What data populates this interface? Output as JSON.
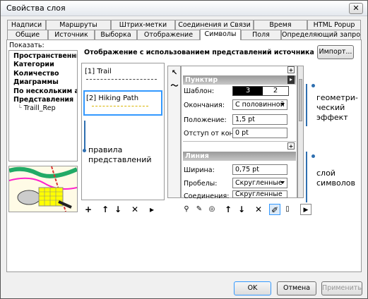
{
  "window": {
    "title": "Свойства слоя",
    "close_glyph": "✕"
  },
  "tabs_back": [
    "Надписи",
    "Маршруты",
    "Штрих-метки",
    "Соединения и Связи",
    "Время",
    "HTML Popup"
  ],
  "tabs_front": [
    "Общие",
    "Источник",
    "Выборка",
    "Отображение",
    "Символы",
    "Поля",
    "Определяющий запрос"
  ],
  "active_tab": "Символы",
  "show_label": "Показать:",
  "categories": [
    "Пространственные объекты",
    "Категории",
    "Количество",
    "Диаграммы",
    "По нескольким атрибутам",
    "Представления"
  ],
  "subcategory": "Traill_Rep",
  "header_text": "Отображение с использованием представлений источника данных объекта",
  "import_button": "Импорт...",
  "rules": [
    "[1] Trail",
    "[2] Hiking Path"
  ],
  "dash_section": {
    "title": "Пунктир",
    "pattern_label": "Шаблон:",
    "pattern_values": [
      "3",
      "2"
    ],
    "ends_label": "Окончания:",
    "ends_value": "С половинной ш",
    "position_label": "Положение:",
    "position_value": "1,5 pt",
    "offset_label": "Отступ от конца:",
    "offset_value": "0 pt"
  },
  "line_section": {
    "title": "Линия",
    "width_label": "Ширина:",
    "width_value": "0,75 pt",
    "caps_label": "Пробелы:",
    "caps_value": "Скругленные",
    "joins_label": "Соединения:",
    "joins_value": "Скругленные"
  },
  "annotations": {
    "rules": "правила представлений",
    "geom": "геометри-ческий эффект",
    "layer": "слой символов"
  },
  "buttons": {
    "ok": "OK",
    "cancel": "Отмена",
    "apply": "Применить"
  },
  "colors": {
    "accent": "#2e6fb0",
    "selected_rule_border": "#3399ff",
    "dash_yellow": "#d9b300"
  }
}
